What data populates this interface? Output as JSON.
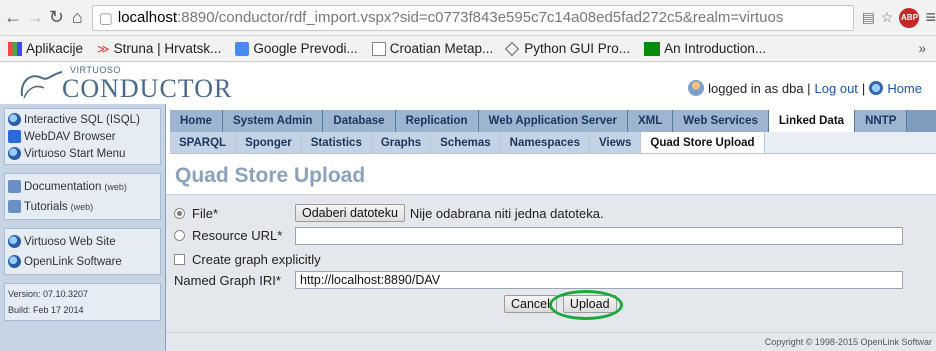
{
  "browser": {
    "url_host": "localhost",
    "url_path": ":8890/conductor/rdf_import.vspx?sid=c0773f843e595c7c14a08ed5fad272c5&realm=virtuos",
    "bookmarks": [
      "Aplikacije",
      "Struna | Hrvatsk...",
      "Google Prevodi...",
      "Croatian Metap...",
      "Python GUI Pro...",
      "An Introduction..."
    ],
    "more": "»",
    "abp": "ABP"
  },
  "header": {
    "logo_small": "VIRTUOSO",
    "logo_big": "CONDUCTOR",
    "logged_in_text": "logged in as dba |",
    "logout": "Log out",
    "separator": "|",
    "home": "Home"
  },
  "sidebar": {
    "group1": [
      "Interactive SQL (ISQL)",
      "WebDAV Browser",
      "Virtuoso Start Menu"
    ],
    "group2": [
      {
        "label": "Documentation",
        "note": "(web)"
      },
      {
        "label": "Tutorials",
        "note": "(web)"
      }
    ],
    "group3": [
      "Virtuoso Web Site",
      "OpenLink Software"
    ],
    "version": "Version: 07.10.3207",
    "build": "Build: Feb 17 2014"
  },
  "tabs": [
    {
      "label": "Home",
      "active": false
    },
    {
      "label": "System Admin",
      "active": false
    },
    {
      "label": "Database",
      "active": false
    },
    {
      "label": "Replication",
      "active": false
    },
    {
      "label": "Web Application Server",
      "active": false
    },
    {
      "label": "XML",
      "active": false
    },
    {
      "label": "Web Services",
      "active": false
    },
    {
      "label": "Linked Data",
      "active": true
    },
    {
      "label": "NNTP",
      "active": false
    }
  ],
  "subtabs": [
    {
      "label": "SPARQL",
      "active": false
    },
    {
      "label": "Sponger",
      "active": false
    },
    {
      "label": "Statistics",
      "active": false
    },
    {
      "label": "Graphs",
      "active": false
    },
    {
      "label": "Schemas",
      "active": false
    },
    {
      "label": "Namespaces",
      "active": false
    },
    {
      "label": "Views",
      "active": false
    },
    {
      "label": "Quad Store Upload",
      "active": true
    }
  ],
  "main": {
    "title": "Quad Store Upload",
    "file_label": "File*",
    "choose_file": "Odaberi datoteku",
    "no_file": "Nije odabrana niti jedna datoteka.",
    "resource_label": "Resource URL*",
    "resource_value": "",
    "create_graph_label": "Create graph explicitly",
    "graph_iri_label": "Named Graph IRI*",
    "graph_iri_value": "http://localhost:8890/DAV",
    "cancel": "Cancel",
    "upload": "Upload"
  },
  "footer": {
    "copyright": "Copyright © 1998-2015 OpenLink Softwar"
  },
  "colors": {
    "accent_green": "#1da83a",
    "tab_bar": "#7e9dbd",
    "title": "#8aa3bd"
  }
}
